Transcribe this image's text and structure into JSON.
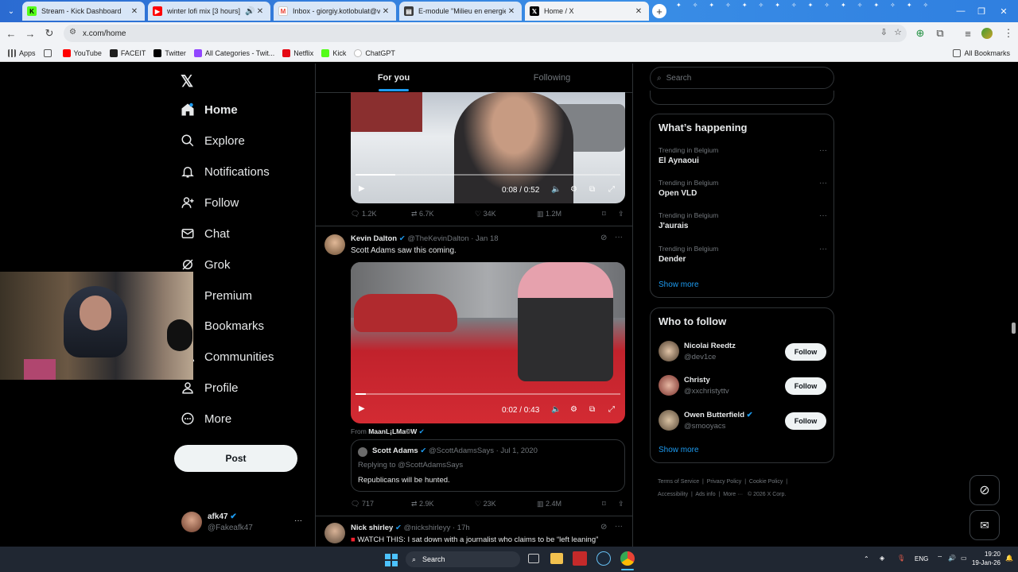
{
  "browser": {
    "tabs": [
      {
        "title": "Stream - Kick Dashboard",
        "icon": "kick-icon",
        "color": "#53fc18"
      },
      {
        "title": "winter lofi mix [3 hours]",
        "icon": "youtube-icon",
        "color": "#ff0000"
      },
      {
        "title": "Inbox - giorgiy.kotlobulat@vda",
        "icon": "gmail-icon",
        "color": "#ea4335"
      },
      {
        "title": "E-module \"Milieu en energie in",
        "icon": "document-icon",
        "color": "#3b3b3b"
      },
      {
        "title": "Home / X",
        "icon": "x-icon",
        "color": "#000000"
      }
    ],
    "url": "x.com/home",
    "bookmarks": [
      {
        "label": "Apps"
      },
      {
        "label": ""
      },
      {
        "label": "YouTube"
      },
      {
        "label": "FACEIT"
      },
      {
        "label": "Twitter"
      },
      {
        "label": "All Categories - Twit..."
      },
      {
        "label": "Netflix"
      },
      {
        "label": "Kick"
      },
      {
        "label": "ChatGPT"
      }
    ],
    "all_bookmarks": "All Bookmarks"
  },
  "nav": {
    "items": [
      {
        "label": "Home",
        "icon": "home-icon"
      },
      {
        "label": "Explore",
        "icon": "search-icon"
      },
      {
        "label": "Notifications",
        "icon": "bell-icon"
      },
      {
        "label": "Follow",
        "icon": "follow-icon"
      },
      {
        "label": "Chat",
        "icon": "mail-icon"
      },
      {
        "label": "Grok",
        "icon": "grok-icon"
      },
      {
        "label": "Premium",
        "icon": "x-icon"
      },
      {
        "label": "Bookmarks",
        "icon": "bookmark-icon"
      },
      {
        "label": "Communities",
        "icon": "communities-icon"
      },
      {
        "label": "Profile",
        "icon": "profile-icon"
      },
      {
        "label": "More",
        "icon": "more-icon"
      }
    ],
    "post_label": "Post",
    "account": {
      "name": "afk47",
      "handle": "@Fakeafk47",
      "more": "···"
    }
  },
  "feed": {
    "tabs": {
      "for_you": "For you",
      "following": "Following"
    },
    "video1": {
      "time": "0:08 / 0:52",
      "progress": 0.15
    },
    "stats1": {
      "replies": "1.2K",
      "reposts": "6.7K",
      "likes": "34K",
      "views": "1.2M"
    },
    "post2": {
      "author": "Kevin Dalton",
      "handle": "@TheKevinDalton",
      "date": "· Jan 18",
      "text": "Scott Adams saw this coming.",
      "video_time": "0:02 / 0:43",
      "video_progress": 0.04,
      "from_prefix": "From",
      "from_name": "MaanL¡LMa©W",
      "quote": {
        "author": "Scott Adams",
        "handle": "@ScottAdamsSays",
        "date": "· Jul 1, 2020",
        "replying": "Replying to @ScottAdamsSays",
        "text": "Republicans will be hunted."
      },
      "stats": {
        "replies": "717",
        "reposts": "2.9K",
        "likes": "23K",
        "views": "2.4M"
      }
    },
    "post3": {
      "author": "Nick shirley",
      "handle": "@nickshirleyy",
      "date": "· 17h",
      "text": "WATCH THIS: I sat down with a journalist who claims to be “left leaning”"
    }
  },
  "sidebar": {
    "search_placeholder": "Search",
    "whats_happening": "What’s happening",
    "trends": [
      {
        "category": "Trending in Belgium",
        "name": "El Aynaoui"
      },
      {
        "category": "Trending in Belgium",
        "name": "Open VLD"
      },
      {
        "category": "Trending in Belgium",
        "name": "J'aurais"
      },
      {
        "category": "Trending in Belgium",
        "name": "Dender"
      }
    ],
    "show_more": "Show more",
    "who_to_follow": "Who to follow",
    "suggestions": [
      {
        "name": "Nicolai Reedtz",
        "handle": "@dev1ce",
        "verified": false
      },
      {
        "name": "Christy",
        "handle": "@xxchristyttv",
        "verified": false
      },
      {
        "name": "Owen Butterfield",
        "handle": "@smooyacs",
        "verified": true
      }
    ],
    "follow_label": "Follow",
    "footer": [
      "Terms of Service",
      "Privacy Policy",
      "Cookie Policy",
      "Accessibility",
      "Ads info",
      "More ···",
      "© 2026 X Corp."
    ]
  },
  "taskbar": {
    "search": "Search",
    "lang": "ENG",
    "time": "19:20",
    "date": "19-Jan-26"
  }
}
